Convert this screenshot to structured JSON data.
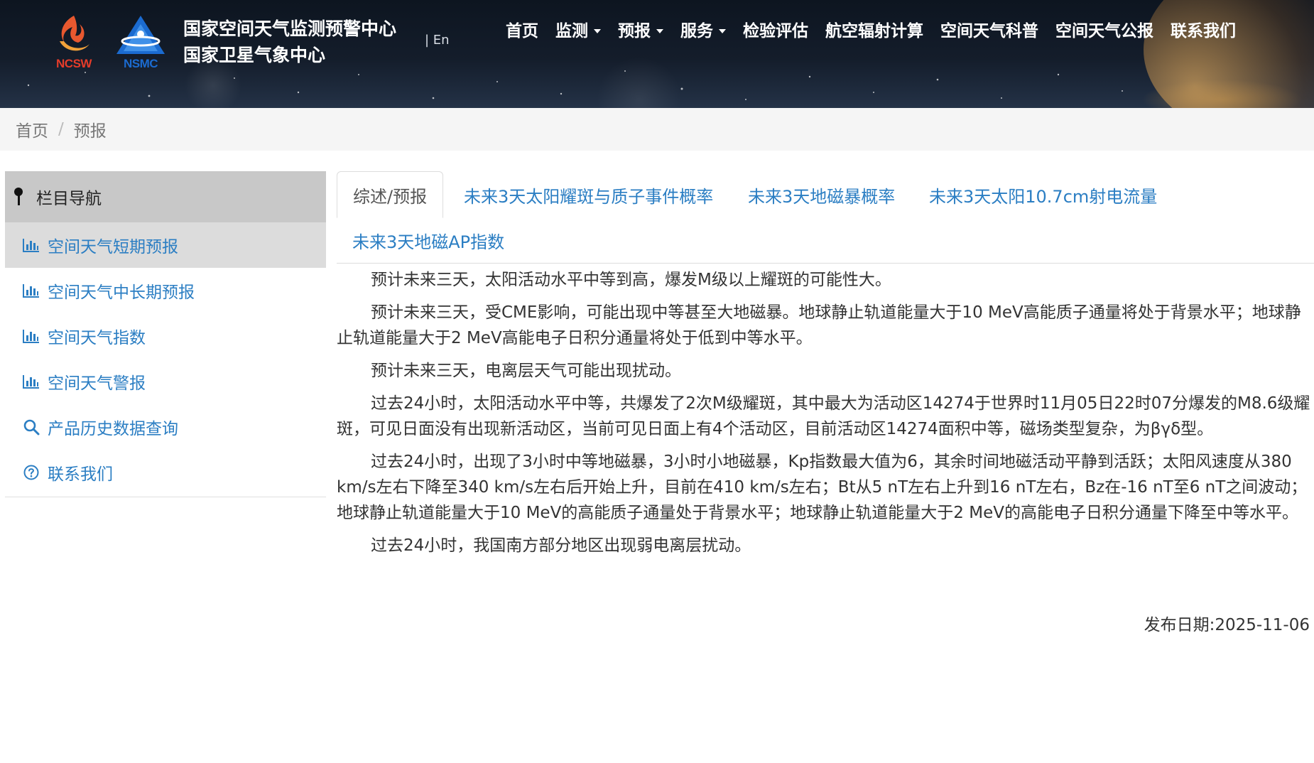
{
  "header": {
    "logo_left_text": "NCSW",
    "logo_right_text": "NSMC",
    "title_line1": "国家空间天气监测预警中心",
    "title_line2": "国家卫星气象中心",
    "lang_label": "| En"
  },
  "nav": {
    "items": [
      {
        "label": "首页",
        "dropdown": false
      },
      {
        "label": "监测",
        "dropdown": true
      },
      {
        "label": "预报",
        "dropdown": true
      },
      {
        "label": "服务",
        "dropdown": true
      },
      {
        "label": "检验评估",
        "dropdown": false
      },
      {
        "label": "航空辐射计算",
        "dropdown": false
      },
      {
        "label": "空间天气科普",
        "dropdown": false
      },
      {
        "label": "空间天气公报",
        "dropdown": false
      },
      {
        "label": "联系我们",
        "dropdown": false
      }
    ]
  },
  "breadcrumb": {
    "home": "首页",
    "separator": "/",
    "current": "预报"
  },
  "sidebar": {
    "heading": "栏目导航",
    "items": [
      {
        "label": "空间天气短期预报",
        "icon": "bar-chart-icon",
        "active": true
      },
      {
        "label": "空间天气中长期预报",
        "icon": "bar-chart-icon",
        "active": false
      },
      {
        "label": "空间天气指数",
        "icon": "bar-chart-icon",
        "active": false
      },
      {
        "label": "空间天气警报",
        "icon": "bar-chart-icon",
        "active": false
      },
      {
        "label": "产品历史数据查询",
        "icon": "search-icon",
        "active": false
      },
      {
        "label": "联系我们",
        "icon": "question-circle-icon",
        "active": false
      }
    ]
  },
  "tabs": [
    {
      "label": "综述/预报",
      "active": true
    },
    {
      "label": "未来3天太阳耀斑与质子事件概率",
      "active": false
    },
    {
      "label": "未来3天地磁暴概率",
      "active": false
    },
    {
      "label": "未来3天太阳10.7cm射电流量",
      "active": false
    },
    {
      "label": "未来3天地磁AP指数",
      "active": false
    }
  ],
  "content": {
    "paragraphs": [
      "预计未来三天，太阳活动水平中等到高，爆发M级以上耀斑的可能性大。",
      "预计未来三天，受CME影响，可能出现中等甚至大地磁暴。地球静止轨道能量大于10 MeV高能质子通量将处于背景水平；地球静止轨道能量大于2 MeV高能电子日积分通量将处于低到中等水平。",
      "预计未来三天，电离层天气可能出现扰动。",
      "过去24小时，太阳活动水平中等，共爆发了2次M级耀斑，其中最大为活动区14274于世界时11月05日22时07分爆发的M8.6级耀斑，可见日面没有出现新活动区，当前可见日面上有4个活动区，目前活动区14274面积中等，磁场类型复杂，为βγδ型。",
      "过去24小时，出现了3小时中等地磁暴，3小时小地磁暴，Kp指数最大值为6，其余时间地磁活动平静到活跃；太阳风速度从380 km/s左右下降至340 km/s左右后开始上升，目前在410 km/s左右；Bt从5 nT左右上升到16 nT左右，Bz在-16 nT至6 nT之间波动；地球静止轨道能量大于10 MeV的高能质子通量处于背景水平；地球静止轨道能量大于2 MeV的高能电子日积分通量下降至中等水平。",
      "过去24小时，我国南方部分地区出现弱电离层扰动。"
    ],
    "pubdate": "发布日期:2025-11-06"
  },
  "colors": {
    "link": "#2b7ec3",
    "header_bg": "#141d2b",
    "sidebar_head_bg": "#c8c8c8",
    "sidebar_active_bg": "#dcdcdc",
    "ncsw_red": "#e53c2a",
    "nsmc_blue": "#1b6bd0"
  }
}
